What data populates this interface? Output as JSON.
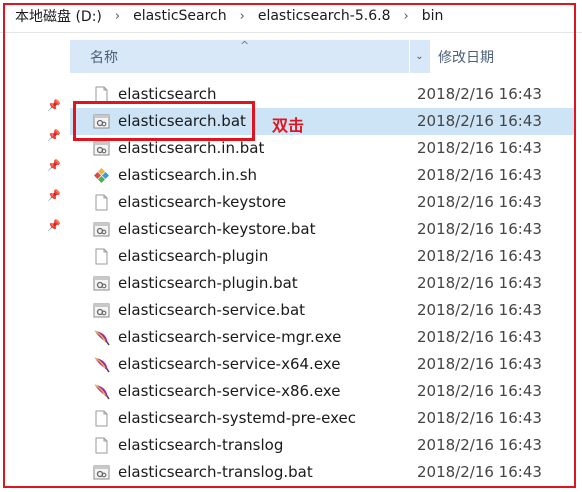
{
  "breadcrumb": [
    "本地磁盘 (D:)",
    "elasticSearch",
    "elasticsearch-5.6.8",
    "bin"
  ],
  "breadcrumb_separator": "›",
  "columns": {
    "name": "名称",
    "date": "修改日期"
  },
  "files": [
    {
      "name": "elasticsearch",
      "date": "2018/2/16 16:43",
      "icon": "blank-file-icon"
    },
    {
      "name": "elasticsearch.bat",
      "date": "2018/2/16 16:43",
      "icon": "batch-file-icon",
      "selected": true
    },
    {
      "name": "elasticsearch.in.bat",
      "date": "2018/2/16 16:43",
      "icon": "batch-file-icon"
    },
    {
      "name": "elasticsearch.in.sh",
      "date": "2018/2/16 16:43",
      "icon": "shell-script-icon"
    },
    {
      "name": "elasticsearch-keystore",
      "date": "2018/2/16 16:43",
      "icon": "blank-file-icon"
    },
    {
      "name": "elasticsearch-keystore.bat",
      "date": "2018/2/16 16:43",
      "icon": "batch-file-icon"
    },
    {
      "name": "elasticsearch-plugin",
      "date": "2018/2/16 16:43",
      "icon": "blank-file-icon"
    },
    {
      "name": "elasticsearch-plugin.bat",
      "date": "2018/2/16 16:43",
      "icon": "batch-file-icon"
    },
    {
      "name": "elasticsearch-service.bat",
      "date": "2018/2/16 16:43",
      "icon": "batch-file-icon"
    },
    {
      "name": "elasticsearch-service-mgr.exe",
      "date": "2018/2/16 16:43",
      "icon": "feather-exe-icon"
    },
    {
      "name": "elasticsearch-service-x64.exe",
      "date": "2018/2/16 16:43",
      "icon": "feather-exe-icon"
    },
    {
      "name": "elasticsearch-service-x86.exe",
      "date": "2018/2/16 16:43",
      "icon": "feather-exe-icon"
    },
    {
      "name": "elasticsearch-systemd-pre-exec",
      "date": "2018/2/16 16:43",
      "icon": "blank-file-icon"
    },
    {
      "name": "elasticsearch-translog",
      "date": "2018/2/16 16:43",
      "icon": "blank-file-icon"
    },
    {
      "name": "elasticsearch-translog.bat",
      "date": "2018/2/16 16:43",
      "icon": "batch-file-icon"
    }
  ],
  "annotation": {
    "text": "双击"
  },
  "colors": {
    "highlight": "#e0141e",
    "selection": "#cde4f7",
    "header": "#d9e8f8"
  }
}
